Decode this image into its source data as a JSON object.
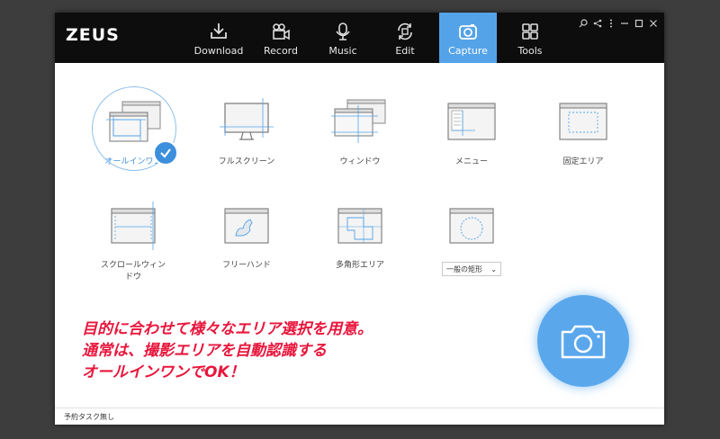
{
  "app": {
    "logo": "ZEUS"
  },
  "nav": {
    "tabs": [
      {
        "label": "Download",
        "icon": "download-icon"
      },
      {
        "label": "Record",
        "icon": "video-camera-icon"
      },
      {
        "label": "Music",
        "icon": "microphone-icon"
      },
      {
        "label": "Edit",
        "icon": "edit-refresh-icon"
      },
      {
        "label": "Capture",
        "icon": "camera-icon",
        "active": true
      },
      {
        "label": "Tools",
        "icon": "tools-grid-icon"
      }
    ]
  },
  "window_controls": [
    "search-icon",
    "share-icon",
    "more-icon",
    "minimize-icon",
    "maximize-icon",
    "close-icon"
  ],
  "capture_modes": [
    {
      "label": "オールインワン",
      "active": true
    },
    {
      "label": "フルスクリーン"
    },
    {
      "label": "ウィンドウ"
    },
    {
      "label": "メニュー"
    },
    {
      "label": "固定エリア"
    },
    {
      "label": "スクロールウィン\nドウ"
    },
    {
      "label": "フリーハンド"
    },
    {
      "label": "多角形エリア"
    }
  ],
  "shape_select": {
    "value": "一般の矩形"
  },
  "promo": {
    "line1": "目的に合わせて様々なエリア選択を用意。",
    "line2": "通常は、撮影エリアを自動認識する",
    "line3": "オールインワンでOK！"
  },
  "status": {
    "text": "予約タスク無し"
  },
  "colors": {
    "accent": "#54a3e8",
    "promo": "#e8163c",
    "titlebar": "#0d0d0d"
  }
}
